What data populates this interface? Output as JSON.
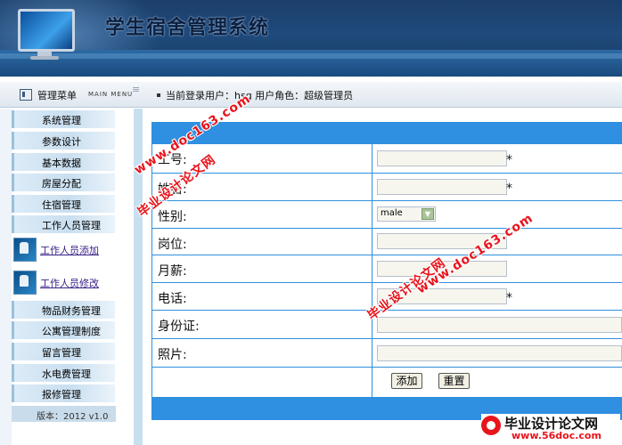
{
  "header": {
    "title": "学生宿舍管理系统"
  },
  "infobar": {
    "menu_title": "管理菜单",
    "menu_subtitle": "MAIN MENU",
    "user_info": "当前登录用户：hsg  用户角色：超级管理员"
  },
  "sidebar": {
    "items_top": [
      "系统管理",
      "参数设计",
      "基本数据",
      "房屋分配",
      "住宿管理",
      "工作人员管理"
    ],
    "sub_items": [
      "工作人员添加",
      "工作人员修改"
    ],
    "items_bottom": [
      "物品财务管理",
      "公寓管理制度",
      "留言管理",
      "水电费管理",
      "报修管理"
    ],
    "version": "版本：2012 v1.0"
  },
  "form": {
    "labels": [
      "工号:",
      "姓名:",
      "性别:",
      "岗位:",
      "月薪:",
      "电话:",
      "身份证:",
      "照片:"
    ],
    "required_mark": "*",
    "gender_value": "male",
    "add_button": "添加",
    "reset_button": "重置"
  },
  "watermarks": {
    "site1": "www.doc163.com",
    "cn1": "毕业设计论文网",
    "site2": "www.doc163.com",
    "cn2": "毕业设计论文网",
    "logo_text": "毕业设计论文网",
    "logo_url": "www.56doc.com"
  }
}
